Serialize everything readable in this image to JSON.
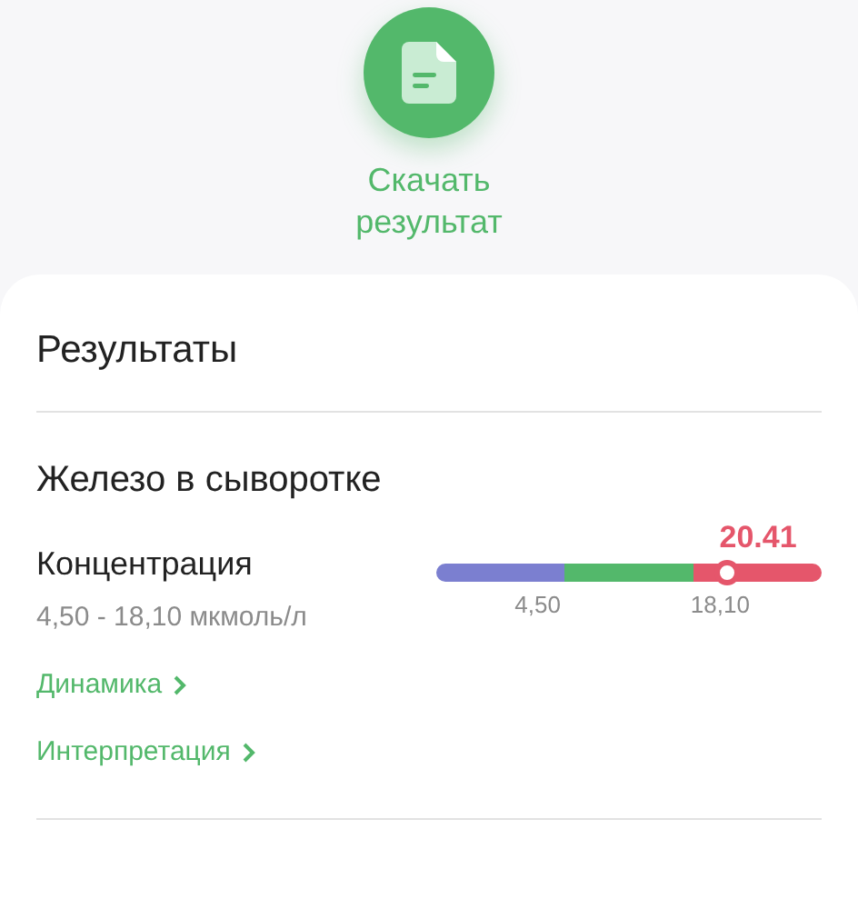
{
  "download": {
    "label": "Скачать результат"
  },
  "card": {
    "title": "Результаты",
    "section": {
      "title": "Железо в сыворотке",
      "indicator": {
        "name": "Концентрация",
        "range": "4,50 - 18,10 мкмоль/л",
        "value": "20.41",
        "level": 0.755,
        "segments": [
          {
            "color": "#7b7fd0"
          },
          {
            "color": "#53b86b"
          },
          {
            "color": "#e5566b"
          }
        ],
        "ticks": [
          "4,50",
          "18,10"
        ]
      },
      "links": [
        "Динамика",
        "Интерпретация"
      ]
    }
  }
}
